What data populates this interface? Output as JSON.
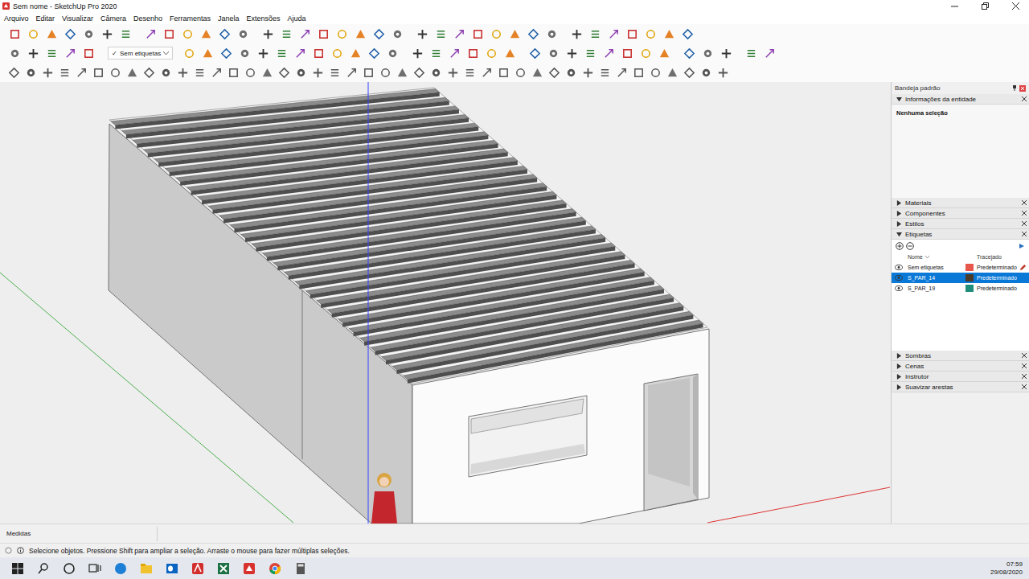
{
  "window": {
    "title": "Sem nome - SketchUp Pro 2020"
  },
  "menu": [
    "Arquivo",
    "Editar",
    "Visualizar",
    "Câmera",
    "Desenho",
    "Ferramentas",
    "Janela",
    "Extensões",
    "Ajuda"
  ],
  "toolbar": {
    "tag_dropdown": {
      "check": "✓",
      "label": "Sem etiquetas"
    }
  },
  "tray": {
    "title": "Bandeja padrão",
    "sections": [
      {
        "label": "Informações da entidade",
        "expanded": true,
        "kind": "entity-info",
        "selection": "Nenhuma seleção"
      },
      {
        "label": "Materiais",
        "expanded": false,
        "kind": "collapsed"
      },
      {
        "label": "Componentes",
        "expanded": false,
        "kind": "collapsed"
      },
      {
        "label": "Estilos",
        "expanded": false,
        "kind": "collapsed"
      },
      {
        "label": "Etiquetas",
        "expanded": true,
        "kind": "tags",
        "columns": [
          "Nome",
          "Tracejado"
        ],
        "rows": [
          {
            "name": "Sem etiquetas",
            "visible": true,
            "color": "#e8574c",
            "dash": "Predeterminado",
            "selected": false,
            "active": true
          },
          {
            "name": "S_PAR_14",
            "visible": true,
            "color": "#4b3a2a",
            "dash": "Predeterminado",
            "selected": true,
            "active": false
          },
          {
            "name": "S_PAR_19",
            "visible": true,
            "color": "#1f8f7c",
            "dash": "Predeterminado",
            "selected": false,
            "active": false
          }
        ]
      },
      {
        "label": "Sombras",
        "expanded": false,
        "kind": "collapsed"
      },
      {
        "label": "Cenas",
        "expanded": false,
        "kind": "collapsed"
      },
      {
        "label": "Instrutor",
        "expanded": false,
        "kind": "collapsed"
      },
      {
        "label": "Suavizar arestas",
        "expanded": false,
        "kind": "collapsed"
      }
    ]
  },
  "measurements": {
    "label": "Medidas",
    "value": ""
  },
  "status_bar": {
    "text": "Selecione objetos. Pressione Shift para ampliar a seleção. Arraste o mouse para fazer múltiplas seleções."
  },
  "taskbar": {
    "time": "07:59",
    "date": "29/08/2020"
  }
}
